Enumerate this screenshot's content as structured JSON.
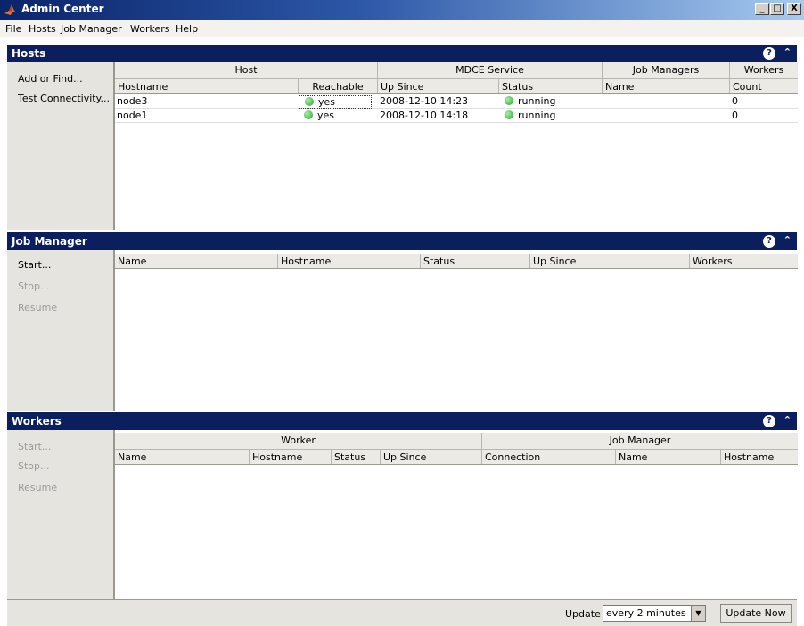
{
  "window": {
    "title": "Admin Center",
    "min_label": "_",
    "max_label": "□",
    "close_label": "X"
  },
  "menu": [
    "File",
    "Hosts",
    "Job Manager",
    "Workers",
    "Help"
  ],
  "colors": {
    "section_header": "#0b1f5e",
    "status_running": "#2ca02c"
  },
  "hosts": {
    "title": "Hosts",
    "actions": [
      "Add or Find...",
      "Test Connectivity..."
    ],
    "groups": [
      "Host",
      "MDCE Service",
      "Job Managers",
      "Workers"
    ],
    "columns": [
      "Hostname",
      "Reachable",
      "Up Since",
      "Status",
      "Name",
      "Count"
    ],
    "rows": [
      {
        "hostname": "node3",
        "reachable": "yes",
        "up_since": "2008-12-10 14:23",
        "status": "running",
        "jm_name": "",
        "count": "0"
      },
      {
        "hostname": "node1",
        "reachable": "yes",
        "up_since": "2008-12-10 14:18",
        "status": "running",
        "jm_name": "",
        "count": "0"
      }
    ]
  },
  "job_manager": {
    "title": "Job Manager",
    "actions": [
      "Start...",
      "Stop...",
      "Resume"
    ],
    "columns": [
      "Name",
      "Hostname",
      "Status",
      "Up Since",
      "Workers"
    ]
  },
  "workers": {
    "title": "Workers",
    "actions": [
      "Start...",
      "Stop...",
      "Resume"
    ],
    "groups": [
      "Worker",
      "Job Manager"
    ],
    "columns": [
      "Name",
      "Hostname",
      "Status",
      "Up Since",
      "Connection",
      "Name",
      "Hostname"
    ]
  },
  "update": {
    "label": "Update",
    "selected": "every 2 minutes",
    "button": "Update Now"
  },
  "icons": {
    "app": "matlab-logo-icon",
    "help": "help-icon",
    "collapse": "collapse-up-icon"
  }
}
